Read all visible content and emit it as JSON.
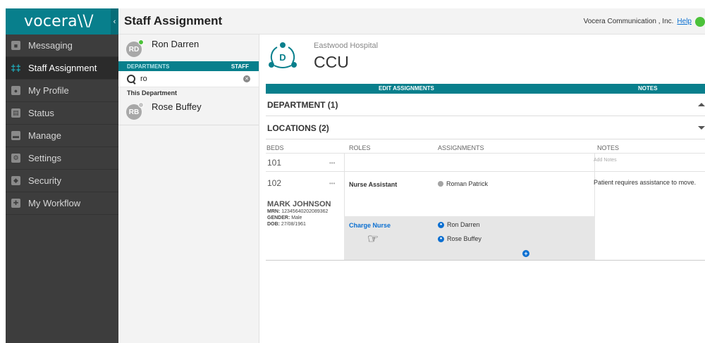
{
  "brand": {
    "logo": "vocera\\\\/",
    "collapse_icon": "chevron-left-icon"
  },
  "sidebar": {
    "items": [
      {
        "label": "Messaging",
        "icon": "message-icon",
        "active": false
      },
      {
        "label": "Staff Assignment",
        "icon": "staff-assignment-icon",
        "active": true
      },
      {
        "label": "My Profile",
        "icon": "profile-icon",
        "active": false
      },
      {
        "label": "Status",
        "icon": "status-icon",
        "active": false
      },
      {
        "label": "Manage",
        "icon": "manage-icon",
        "active": false
      },
      {
        "label": "Settings",
        "icon": "gear-icon",
        "active": false
      },
      {
        "label": "Security",
        "icon": "shield-icon",
        "active": false
      },
      {
        "label": "My Workflow",
        "icon": "workflow-icon",
        "active": false
      }
    ]
  },
  "header": {
    "title": "Staff Assignment",
    "company": "Vocera Communication , Inc.",
    "help": "Help"
  },
  "staff_panel": {
    "current_user": {
      "initials": "RD",
      "name": "Ron Darren"
    },
    "tabs": {
      "departments": "DEPARTMENTS",
      "staff": "STAFF"
    },
    "search": {
      "value": "ro",
      "placeholder": ""
    },
    "section_label": "This Department",
    "results": [
      {
        "initials": "RB",
        "name": "Rose Buffey"
      }
    ]
  },
  "main": {
    "hospital": "Eastwood Hospital",
    "unit": "CCU",
    "unit_icon_letter": "D",
    "bar": {
      "edit": "EDIT ASSIGNMENTS",
      "notes": "NOTES"
    },
    "department": "DEPARTMENT (1)",
    "locations": "LOCATIONS (2)",
    "columns": {
      "beds": "BEDS",
      "roles": "ROLES",
      "assignments": "ASSIGNMENTS",
      "notes": "NOTES"
    },
    "rows": {
      "bed1": "101",
      "bed1_notes_placeholder": "Add Notes",
      "bed2": "102",
      "role1": "Nurse Assistant",
      "role1_assignee": "Roman Patrick",
      "note": "Patient requires assistance to move.",
      "patient": {
        "name": "MARK JOHNSON",
        "mrn_label": "MRN:",
        "mrn": "12345640202089362",
        "gender_label": "GENDER:",
        "gender": "Male",
        "dob_label": "DOB:",
        "dob": "27/08/1961"
      },
      "role2": "Charge Nurse",
      "role2_assignees": [
        "Ron Darren",
        "Rose Buffey"
      ]
    },
    "more_glyph": "•••",
    "plus": "+"
  },
  "colors": {
    "teal": "#087f8c",
    "link": "#0a6fd1",
    "online": "#4cc23a"
  }
}
